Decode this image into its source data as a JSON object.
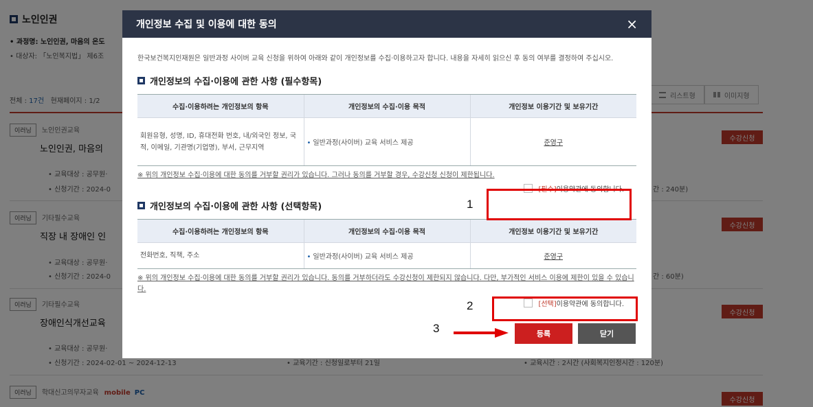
{
  "background": {
    "title": "노인인권",
    "line1": "• 과정명: 노인인권, 마음의 온도",
    "line2": "• 대상자: 「노인복지법」 제6조",
    "count_label": "전체 : ",
    "count_value": "17건",
    "page_label": "현재페이지 : 1/2",
    "view_list": "리스트형",
    "view_image": "이미지형",
    "courses": [
      {
        "tag": "이러닝",
        "category": "노인인권교육",
        "title": "노인인권, 마음의",
        "target": "• 교육대상 : 공무원·",
        "period": "• 신청기간 : 2024-0",
        "time": "간 : 240분)",
        "apply": "수강신청"
      },
      {
        "tag": "이러닝",
        "category": "기타필수교육",
        "title": "직장 내 장애인 인",
        "target": "• 교육대상 : 공무원·",
        "period": "• 신청기간 : 2024-0",
        "time": "간 : 60분)",
        "apply": "수강신청"
      },
      {
        "tag": "이러닝",
        "category": "기타필수교육",
        "title": "장애인식개선교육",
        "target": "• 교육대상 : 공무원·",
        "period": "• 신청기간 : 2024-02-01 ~ 2024-12-13",
        "period2": "• 교육기간 : 신청일로부터 21일",
        "time": "• 교육시간 : 2시간 (사회복지인정시간 : 120분)",
        "apply": "수강신청"
      },
      {
        "tag": "이러닝",
        "category": "학대신고의무자교육",
        "mobile": "mobile",
        "pc": "PC",
        "apply": "수강신청"
      }
    ]
  },
  "modal": {
    "title": "개인정보 수집 및 이용에 대한 동의",
    "close_icon": "×",
    "intro": "한국보건복지인재원은 일반과정 사이버 교육 신청을 위하여 아래와 같이 개인정보를 수집·이용하고자 합니다. 내용을 자세히 읽으신 후 동의 여부를 결정하여 주십시오.",
    "required": {
      "section_title": "개인정보의 수집·이용에 관한 사항 (필수항목)",
      "headers": [
        "수집·이용하려는 개인정보의 항목",
        "개인정보의 수집·이용 목적",
        "개인정보 이용기간 및 보유기간"
      ],
      "items": "회원유형, 성명, ID, 휴대전화 번호, 내/외국인 정보, 국적, 이메일, 기관명(기업명), 부서, 근무지역",
      "purpose": "일반과정(사이버) 교육 서비스 제공",
      "period": "준영구",
      "note": "※ 위의 개인정보 수집·이용에 대한 동의를 거부할 권리가 있습니다. 그러나 동의를 거부할 경우, 수강신청 신청이 제한됩니다.",
      "agree_tag": "[필수]",
      "agree_text": "이용약관에 동의합니다."
    },
    "optional": {
      "section_title": "개인정보의 수집·이용에 관한 사항 (선택항목)",
      "headers": [
        "수집·이용하려는 개인정보의 항목",
        "개인정보의 수집·이용 목적",
        "개인정보 이용기간 및 보유기간"
      ],
      "items": "전화번호, 직책, 주소",
      "purpose": "일반과정(사이버) 교육 서비스 제공",
      "period": "준영구",
      "note": "※ 위의 개인정보 수집·이용에 대한 동의를 거부할 권리가 있습니다. 동의를 거부하더라도 수강신청이 제한되지 않습니다. 다만, 부가적인 서비스 이용에 제한이 있을 수 있습니다.",
      "agree_tag": "[선택]",
      "agree_text": "이용약관에 동의합니다."
    },
    "submit_label": "등록",
    "close_label": "닫기"
  },
  "annotations": [
    "1",
    "2",
    "3"
  ],
  "colors": {
    "header": "#2c3446",
    "accent": "#cc1f1f",
    "annotation": "#e00000"
  }
}
